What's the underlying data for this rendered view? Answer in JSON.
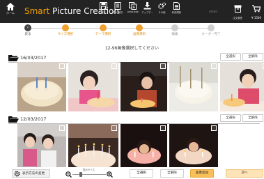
{
  "header": {
    "home_label": "ホーム",
    "brand_smart": "Smart",
    "brand_rest": " Picture Creation",
    "icons": [
      {
        "name": "save-icon",
        "label": "保存"
      },
      {
        "name": "open-icon",
        "label": "開く保存"
      },
      {
        "name": "language-icon",
        "label": "Language"
      },
      {
        "name": "upload-icon",
        "label": "アップデ..."
      },
      {
        "name": "settings-icon",
        "label": "その他"
      },
      {
        "name": "guide-icon",
        "label": "利用規約"
      }
    ],
    "small_label": "ｍｍｍ",
    "cart_label": "注文履歴",
    "total": "¥ 1500"
  },
  "steps": [
    {
      "label": "戻る",
      "state": "done"
    },
    {
      "label": "サイズ選択",
      "state": "active"
    },
    {
      "label": "テーマ選択",
      "state": "active"
    },
    {
      "label": "画像選択",
      "state": "active"
    },
    {
      "label": "編集",
      "state": "pending"
    },
    {
      "label": "オーダー完了",
      "state": "pending"
    }
  ],
  "instruction": "12-96画像選択してください",
  "groups": [
    {
      "date": "16/03/2017",
      "select_all": "全選択",
      "clear_all": "全解除"
    },
    {
      "date": "12/03/2017",
      "select_all": "全選択",
      "clear_all": "全解除"
    }
  ],
  "footer": {
    "settings_label": "表示方法の変更",
    "zoom_label": "表示サイズ",
    "zoom_level": 0.25,
    "select_all": "全選択",
    "clear_all": "全解除",
    "auto_select": "画像追加",
    "next": "次へ"
  },
  "colors": {
    "header_bg": "#232323",
    "accent": "#f4a000",
    "button_orange": "#f9c05a"
  }
}
